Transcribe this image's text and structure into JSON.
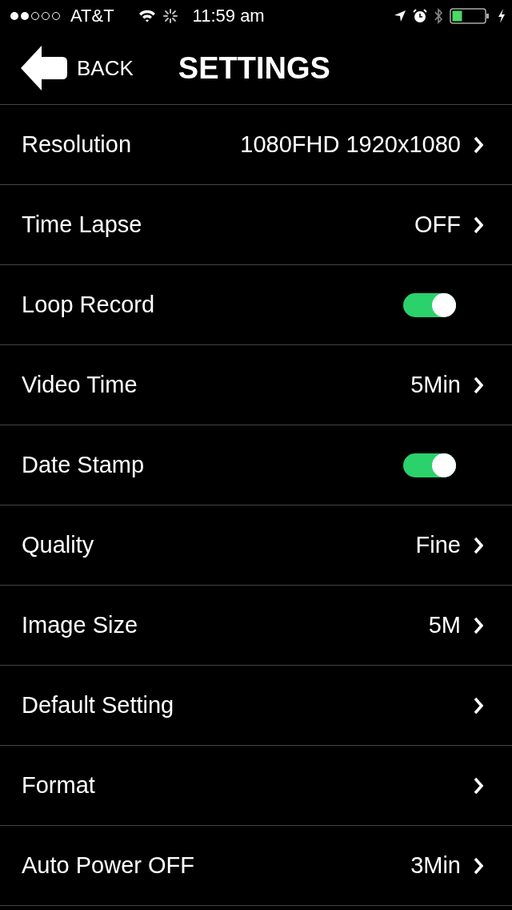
{
  "status_bar": {
    "carrier": "AT&T",
    "time": "11:59 am"
  },
  "header": {
    "back": "BACK",
    "title": "SETTINGS"
  },
  "rows": [
    {
      "kind": "value",
      "label": "Resolution",
      "value": "1080FHD 1920x1080"
    },
    {
      "kind": "value",
      "label": "Time Lapse",
      "value": "OFF"
    },
    {
      "kind": "toggle",
      "label": "Loop Record",
      "on": true
    },
    {
      "kind": "value",
      "label": "Video Time",
      "value": "5Min"
    },
    {
      "kind": "toggle",
      "label": "Date Stamp",
      "on": true
    },
    {
      "kind": "value",
      "label": "Quality",
      "value": "Fine"
    },
    {
      "kind": "value",
      "label": "Image Size",
      "value": "5M"
    },
    {
      "kind": "value",
      "label": "Default Setting"
    },
    {
      "kind": "value",
      "label": "Format"
    },
    {
      "kind": "value",
      "label": "Auto Power OFF",
      "value": "3Min"
    }
  ]
}
